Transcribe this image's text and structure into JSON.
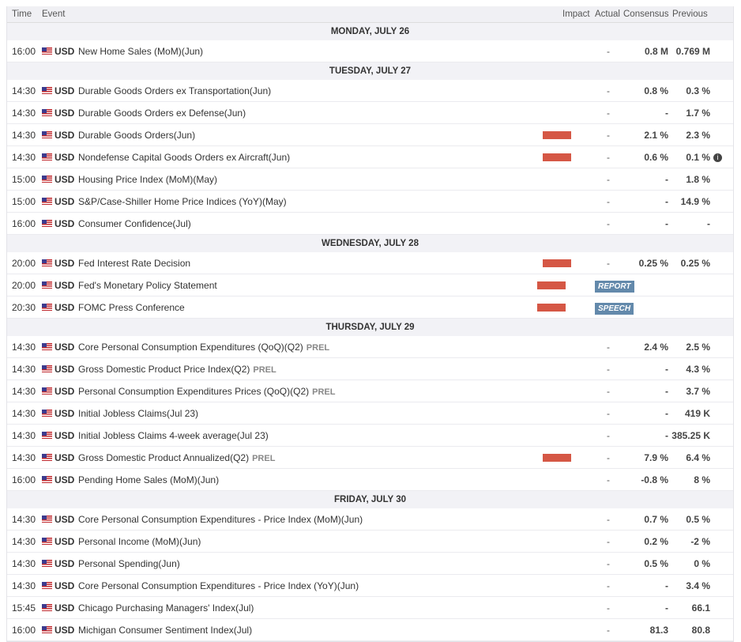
{
  "header": {
    "time": "Time",
    "event": "Event",
    "impact": "Impact",
    "actual": "Actual",
    "consensus": "Consensus",
    "previous": "Previous"
  },
  "colors": {
    "medium": "#e8891c",
    "high": "#d55745",
    "badge": "#6389ab"
  },
  "days": [
    {
      "label": "MONDAY, JULY 26",
      "events": [
        {
          "time": "16:00",
          "currency": "USD",
          "name": "New Home Sales (MoM)(Jun)",
          "impact": "medium",
          "actual": "-",
          "consensus": "0.8 M",
          "previous": "0.769 M"
        }
      ]
    },
    {
      "label": "TUESDAY, JULY 27",
      "events": [
        {
          "time": "14:30",
          "currency": "USD",
          "name": "Durable Goods Orders ex Transportation(Jun)",
          "impact": "medium",
          "actual": "-",
          "consensus": "0.8 %",
          "previous": "0.3 %"
        },
        {
          "time": "14:30",
          "currency": "USD",
          "name": "Durable Goods Orders ex Defense(Jun)",
          "impact": "medium",
          "actual": "-",
          "consensus": "-",
          "previous": "1.7 %"
        },
        {
          "time": "14:30",
          "currency": "USD",
          "name": "Durable Goods Orders(Jun)",
          "impact": "high",
          "actual": "-",
          "consensus": "2.1 %",
          "previous": "2.3 %"
        },
        {
          "time": "14:30",
          "currency": "USD",
          "name": "Nondefense Capital Goods Orders ex Aircraft(Jun)",
          "impact": "high",
          "actual": "-",
          "consensus": "0.6 %",
          "previous": "0.1 %",
          "info": "i"
        },
        {
          "time": "15:00",
          "currency": "USD",
          "name": "Housing Price Index (MoM)(May)",
          "impact": "medium",
          "actual": "-",
          "consensus": "-",
          "previous": "1.8 %"
        },
        {
          "time": "15:00",
          "currency": "USD",
          "name": "S&P/Case-Shiller Home Price Indices (YoY)(May)",
          "impact": "medium",
          "actual": "-",
          "consensus": "-",
          "previous": "14.9 %"
        },
        {
          "time": "16:00",
          "currency": "USD",
          "name": "Consumer Confidence(Jul)",
          "impact": "medium",
          "actual": "-",
          "consensus": "-",
          "previous": "-"
        }
      ]
    },
    {
      "label": "WEDNESDAY, JULY 28",
      "events": [
        {
          "time": "20:00",
          "currency": "USD",
          "name": "Fed Interest Rate Decision",
          "impact": "high",
          "actual": "-",
          "consensus": "0.25 %",
          "previous": "0.25 %"
        },
        {
          "time": "20:00",
          "currency": "USD",
          "name": "Fed's Monetary Policy Statement",
          "impact": "high",
          "badge": "REPORT"
        },
        {
          "time": "20:30",
          "currency": "USD",
          "name": "FOMC Press Conference",
          "impact": "high",
          "badge": "SPEECH"
        }
      ]
    },
    {
      "label": "THURSDAY, JULY 29",
      "events": [
        {
          "time": "14:30",
          "currency": "USD",
          "name": "Core Personal Consumption Expenditures (QoQ)(Q2)",
          "prel": "PREL",
          "impact": "medium",
          "actual": "-",
          "consensus": "2.4 %",
          "previous": "2.5 %"
        },
        {
          "time": "14:30",
          "currency": "USD",
          "name": "Gross Domestic Product Price Index(Q2)",
          "prel": "PREL",
          "impact": "medium",
          "actual": "-",
          "consensus": "-",
          "previous": "4.3 %"
        },
        {
          "time": "14:30",
          "currency": "USD",
          "name": "Personal Consumption Expenditures Prices (QoQ)(Q2)",
          "prel": "PREL",
          "impact": "medium",
          "actual": "-",
          "consensus": "-",
          "previous": "3.7 %"
        },
        {
          "time": "14:30",
          "currency": "USD",
          "name": "Initial Jobless Claims(Jul 23)",
          "impact": "medium",
          "actual": "-",
          "consensus": "-",
          "previous": "419 K"
        },
        {
          "time": "14:30",
          "currency": "USD",
          "name": "Initial Jobless Claims 4-week average(Jul 23)",
          "impact": "medium",
          "actual": "-",
          "consensus": "-",
          "previous": "385.25 K"
        },
        {
          "time": "14:30",
          "currency": "USD",
          "name": "Gross Domestic Product Annualized(Q2)",
          "prel": "PREL",
          "impact": "high",
          "actual": "-",
          "consensus": "7.9 %",
          "previous": "6.4 %"
        },
        {
          "time": "16:00",
          "currency": "USD",
          "name": "Pending Home Sales (MoM)(Jun)",
          "impact": "medium",
          "actual": "-",
          "consensus": "-0.8 %",
          "previous": "8 %"
        }
      ]
    },
    {
      "label": "FRIDAY, JULY 30",
      "events": [
        {
          "time": "14:30",
          "currency": "USD",
          "name": "Core Personal Consumption Expenditures - Price Index (MoM)(Jun)",
          "impact": "medium",
          "actual": "-",
          "consensus": "0.7 %",
          "previous": "0.5 %"
        },
        {
          "time": "14:30",
          "currency": "USD",
          "name": "Personal Income (MoM)(Jun)",
          "impact": "medium",
          "actual": "-",
          "consensus": "0.2 %",
          "previous": "-2 %"
        },
        {
          "time": "14:30",
          "currency": "USD",
          "name": "Personal Spending(Jun)",
          "impact": "medium",
          "actual": "-",
          "consensus": "0.5 %",
          "previous": "0 %"
        },
        {
          "time": "14:30",
          "currency": "USD",
          "name": "Core Personal Consumption Expenditures - Price Index (YoY)(Jun)",
          "impact": "medium",
          "actual": "-",
          "consensus": "-",
          "previous": "3.4 %"
        },
        {
          "time": "15:45",
          "currency": "USD",
          "name": "Chicago Purchasing Managers' Index(Jul)",
          "impact": "medium",
          "actual": "-",
          "consensus": "-",
          "previous": "66.1"
        },
        {
          "time": "16:00",
          "currency": "USD",
          "name": "Michigan Consumer Sentiment Index(Jul)",
          "impact": "medium",
          "actual": "-",
          "consensus": "81.3",
          "previous": "80.8"
        }
      ]
    }
  ]
}
